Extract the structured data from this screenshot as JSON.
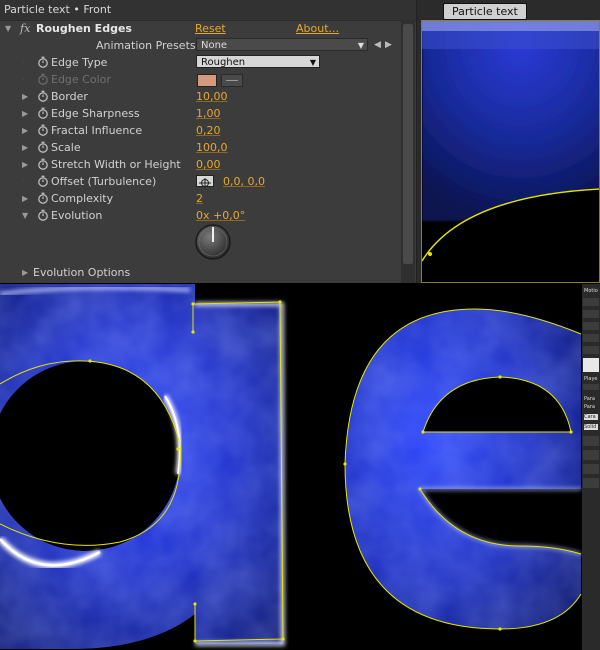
{
  "panel": {
    "header": "Particle text • Front",
    "effect_name": "Roughen Edges",
    "fx": "fx",
    "reset": "Reset",
    "about": "About...",
    "presets_label": "Animation Presets:",
    "presets_value": "None",
    "properties": [
      {
        "label": "Edge Type",
        "value": "Roughen",
        "kind": "dropdown"
      },
      {
        "label": "Edge Color",
        "value": "",
        "kind": "color",
        "color": "#d49a80"
      },
      {
        "label": "Border",
        "value": "10,00",
        "kind": "number"
      },
      {
        "label": "Edge Sharpness",
        "value": "1,00",
        "kind": "number"
      },
      {
        "label": "Fractal Influence",
        "value": "0,20",
        "kind": "number"
      },
      {
        "label": "Scale",
        "value": "100,0",
        "kind": "number"
      },
      {
        "label": "Stretch Width or Height",
        "value": "0,00",
        "kind": "number"
      },
      {
        "label": "Offset (Turbulence)",
        "value": "0,0, 0,0",
        "kind": "point"
      },
      {
        "label": "Complexity",
        "value": "2",
        "kind": "number"
      },
      {
        "label": "Evolution",
        "value": "0x +0,0°",
        "kind": "angle"
      }
    ],
    "evolution_options": "Evolution Options"
  },
  "viewer": {
    "tab_label": "Particle text"
  },
  "strip": {
    "labels": [
      "Motio",
      "Playe",
      "Para",
      "Para",
      "Cara",
      "Solid"
    ]
  },
  "colors": {
    "accent": "#e8a72c",
    "mask_yellow": "#e6e600",
    "glow_blue": "#2e3cff"
  }
}
